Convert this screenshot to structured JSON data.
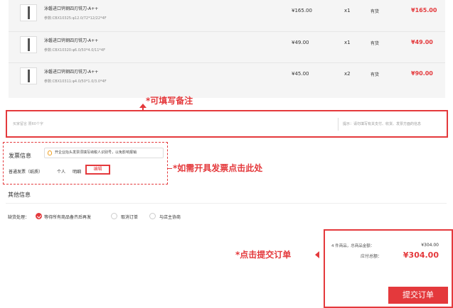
{
  "products": [
    {
      "name": "泳磐进口钨钢四刃铣刀-A++",
      "spec": "参数:CBX10325:φ12.0/72*12/22*4F",
      "price": "¥165.00",
      "qty": "x1",
      "stock": "有货",
      "subtotal": "¥165.00"
    },
    {
      "name": "泳磐进口钨钢四刃铣刀-A++",
      "spec": "参数:CBX10320:φ6.0/50*4.0/11*4F",
      "price": "¥49.00",
      "qty": "x1",
      "stock": "有货",
      "subtotal": "¥49.00"
    },
    {
      "name": "泳磐进口钨钢四刃铣刀-A++",
      "spec": "参数:CBX10311:φ4.0/50*1.0/3.0*4F",
      "price": "¥45.00",
      "qty": "x2",
      "stock": "有货",
      "subtotal": "¥90.00"
    }
  ],
  "annotations": {
    "remark": "*可填写备注",
    "invoice": "*如需开具发票点击此处",
    "submit": "*点击提交订单"
  },
  "remark": {
    "placeholder": "买家留言 限60个字",
    "tip": "提示：请勿填写有关支付、收货、发票方面的信息"
  },
  "invoice": {
    "title": "发票信息",
    "tip": "开企业抬头发票须填写纳税人识别号，以免影响报销",
    "type": "普通发票（纸质）",
    "person": "个人",
    "detail": "明细",
    "edit": "编辑"
  },
  "other": {
    "title": "其他信息",
    "lack_label": "缺货处理：",
    "options": [
      "等待所有商品备齐后再发",
      "取消订单",
      "与店主协商"
    ],
    "selected": 0
  },
  "summary": {
    "count_text": "4 件商品，总商品金额：",
    "amount": "¥304.00",
    "due_label": "应付总额：",
    "due": "¥304.00",
    "submit": "提交订单"
  },
  "colors": {
    "accent": "#e4393c"
  }
}
